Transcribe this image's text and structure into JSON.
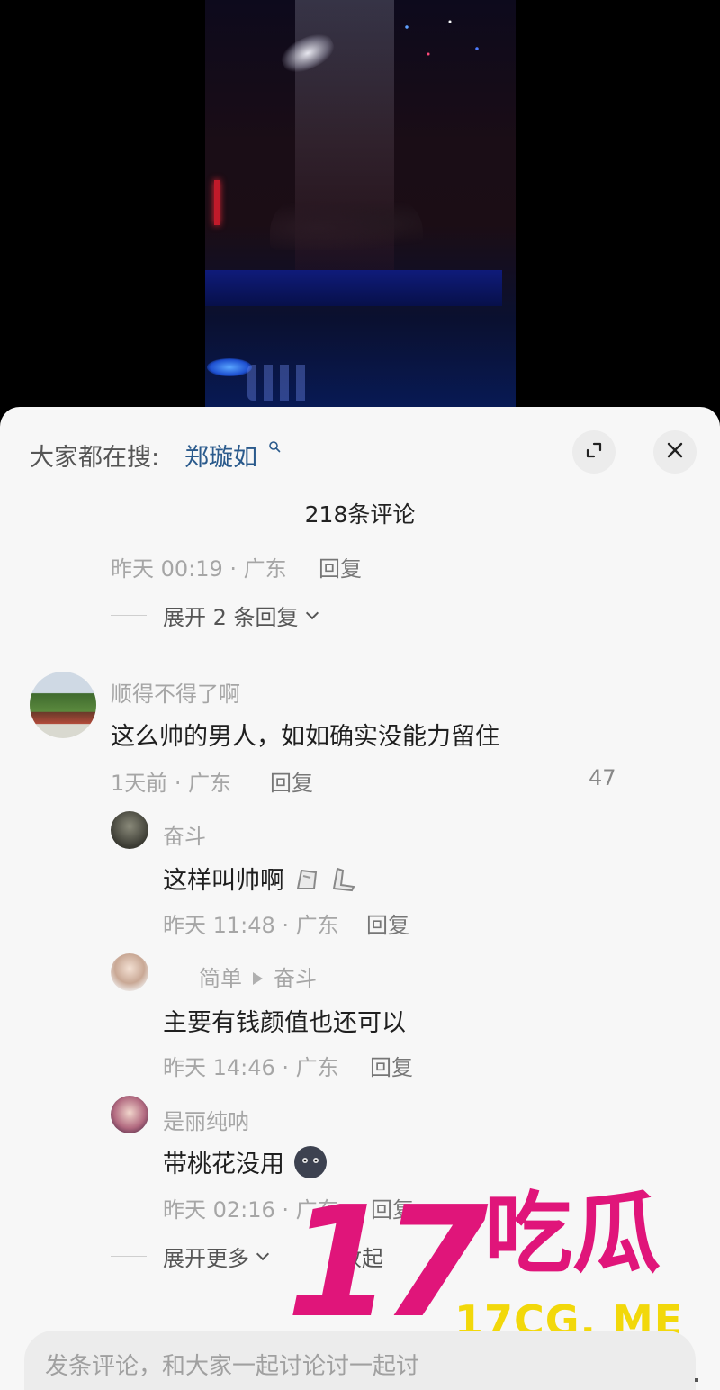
{
  "search": {
    "prefix": "大家都在搜:",
    "term": "郑璇如"
  },
  "icons": [
    "search-icon",
    "expand-icon",
    "close-icon",
    "chevron-down-icon",
    "sticker-icon",
    "emoji-icon"
  ],
  "header": {
    "title": "218条评论"
  },
  "prev_comment": {
    "meta": "昨天 00:19 · 广东",
    "reply_label": "回复",
    "expand_label": "展开 2 条回复"
  },
  "comment": {
    "username": "顺得不得了啊",
    "text": "这么帅的男人，如如确实没能力留住",
    "meta": "1天前 · 广东",
    "reply_label": "回复",
    "likes": "47",
    "replies": [
      {
        "username": "奋斗",
        "text": "这样叫帅啊",
        "meta": "昨天 11:48 · 广东",
        "reply_label": "回复"
      },
      {
        "username": "简单",
        "reply_to": "奋斗",
        "text": "主要有钱颜值也还可以",
        "meta": "昨天 14:46 · 广东",
        "reply_label": "回复"
      },
      {
        "username": "是丽纯呐",
        "text": "带桃花没用",
        "meta": "昨天 02:16 · 广东",
        "reply_label": "回复"
      }
    ],
    "expand_more_label": "展开更多",
    "collapse_label": "收起"
  },
  "input": {
    "placeholder": "发条评论，和大家一起讨论讨一起讨"
  },
  "watermark": {
    "number": "17",
    "chinese": "吃瓜",
    "url": "17CG. ME"
  },
  "colors": {
    "search_term": "#2a5a8c",
    "watermark_pink": "#e0157a",
    "watermark_yellow": "#f2d80a"
  }
}
